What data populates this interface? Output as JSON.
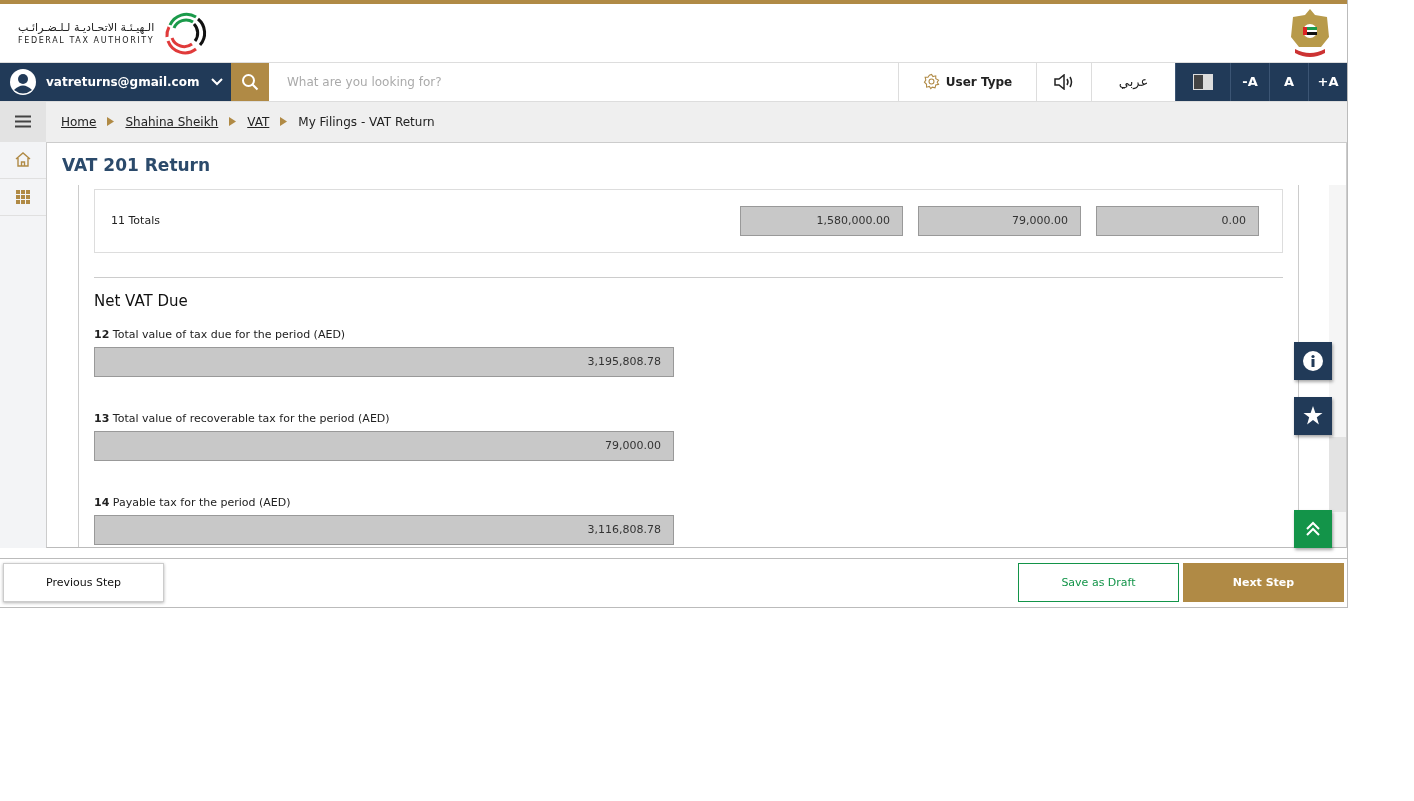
{
  "header": {
    "logo_arabic": "الـهيـئـة الاتحـاديـة لـلـضـرائـب",
    "logo_english": "FEDERAL TAX AUTHORITY"
  },
  "nav": {
    "user_email": "vatreturns@gmail.com",
    "search": {
      "placeholder": "What are you looking for?"
    },
    "user_type": "User Type",
    "language": "عربي",
    "font_buttons": [
      "-A",
      "A",
      "+A"
    ]
  },
  "breadcrumb": [
    {
      "label": "Home",
      "link": true
    },
    {
      "label": "Shahina Sheikh",
      "link": true
    },
    {
      "label": "VAT",
      "link": true
    },
    {
      "label": "My Filings - VAT Return",
      "link": false
    }
  ],
  "page_title": "VAT 201 Return",
  "totals": {
    "label": "11 Totals",
    "values": [
      "1,580,000.00",
      "79,000.00",
      "0.00"
    ]
  },
  "net_vat": {
    "heading": "Net VAT Due",
    "fields": [
      {
        "label": "**12** Total value of tax due for the period (AED)",
        "value": "3,195,808.78"
      },
      {
        "label": "**13** Total value of recoverable tax for the period (AED)",
        "value": "79,000.00"
      },
      {
        "label": "**14** Payable tax for the period (AED)",
        "value": "3,116,808.78"
      }
    ]
  },
  "footer": {
    "previous": "Previous Step",
    "save": "Save as Draft",
    "next": "Next Step"
  }
}
